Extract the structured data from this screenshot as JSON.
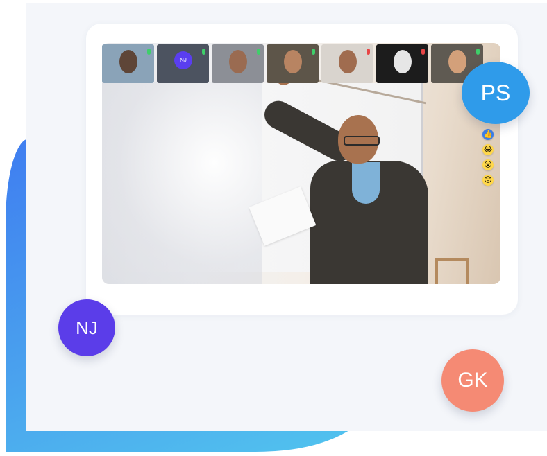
{
  "avatars": [
    {
      "id": "ps",
      "initials": "PS",
      "color": "#2f9bea"
    },
    {
      "id": "nj",
      "initials": "NJ",
      "color": "#5b3de9"
    },
    {
      "id": "gk",
      "initials": "GK",
      "color": "#f58a74"
    }
  ],
  "video_call": {
    "participants": [
      {
        "name": "",
        "tile": "photo",
        "face_color": "#5e4537",
        "bg": "#8aa3b8",
        "mic": "green"
      },
      {
        "name": "",
        "tile": "initials",
        "initials": "NJ",
        "bg": "#4c5360",
        "mic": "green"
      },
      {
        "name": "",
        "tile": "photo",
        "face_color": "#9a6b51",
        "bg": "#8c8f96",
        "mic": "green"
      },
      {
        "name": "",
        "tile": "photo",
        "face_color": "#b88462",
        "bg": "#5d5549",
        "mic": "green"
      },
      {
        "name": "",
        "tile": "photo",
        "face_color": "#a06c4f",
        "bg": "#d9d4ce",
        "mic": "red"
      },
      {
        "name": "",
        "tile": "photo",
        "face_color": "#e6e6e6",
        "bg": "#1c1c1c",
        "mic": "red"
      },
      {
        "name": "",
        "tile": "photo",
        "face_color": "#d3a07a",
        "bg": "#5f5a52",
        "mic": "green"
      }
    ],
    "reactions": [
      "👍",
      "😂",
      "😮",
      "😯"
    ]
  },
  "colors": {
    "brand_blue": "#3f7df0",
    "panel": "#f4f6fa",
    "card": "#ffffff"
  }
}
